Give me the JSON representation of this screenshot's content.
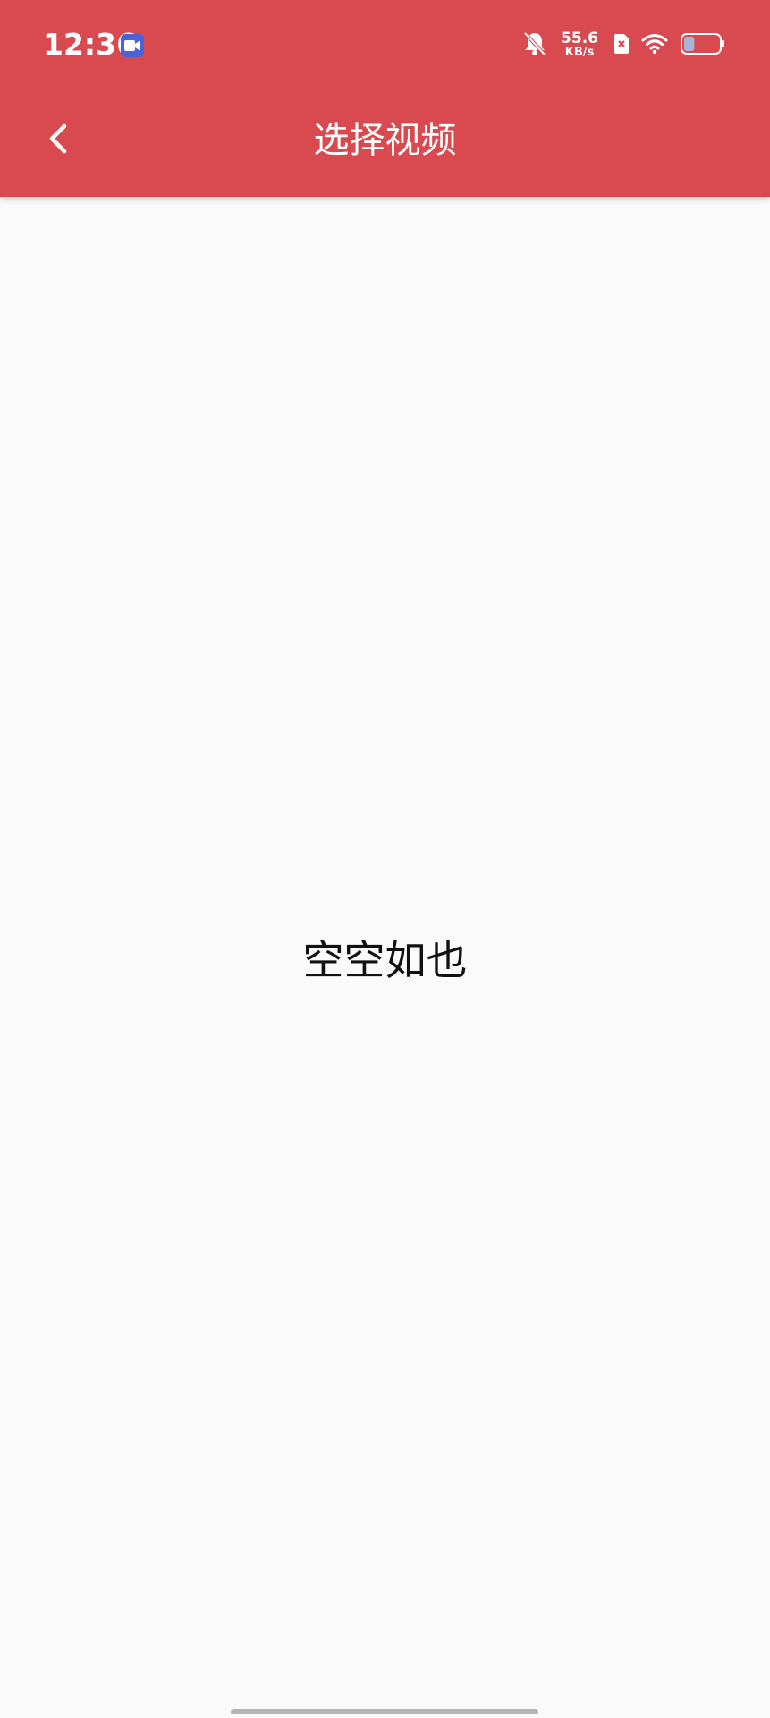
{
  "status_bar": {
    "time": "12:36",
    "net_speed_value": "55.6",
    "net_speed_unit": "KB/s",
    "battery_level": 0.3,
    "icons": [
      "video-recorder-icon",
      "bell-muted-icon",
      "sim-no-signal-icon",
      "wifi-icon",
      "battery-icon"
    ]
  },
  "header": {
    "title": "选择视频",
    "back_icon": "chevron-left-icon"
  },
  "main": {
    "empty_text": "空空如也"
  },
  "colors": {
    "app_bar": "#d94a50",
    "background": "#fafafa",
    "video_icon_badge": "#4b63d9",
    "battery_fill": "#a9b4d6"
  }
}
